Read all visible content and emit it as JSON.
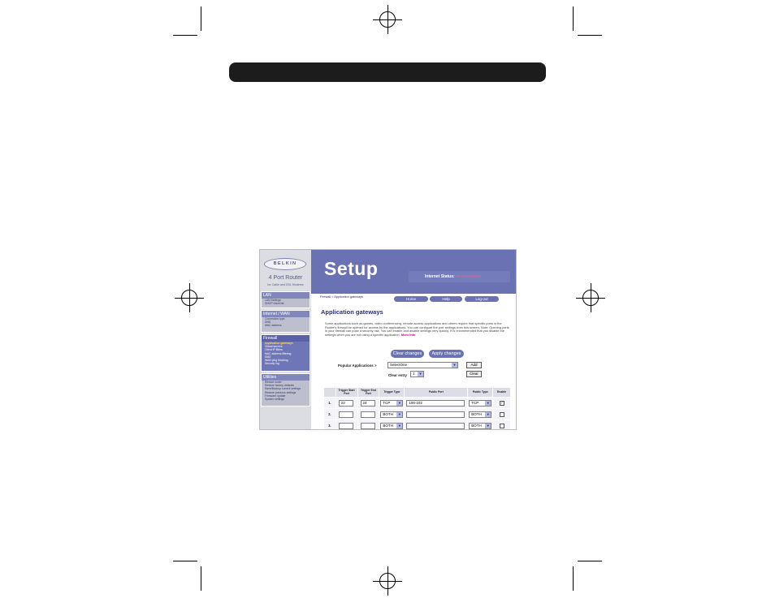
{
  "sidebar": {
    "logo": "BELKIN",
    "product_name": "4 Port Router",
    "product_sub": "for Cable and DSL Modems",
    "groups": [
      {
        "title": "LAN",
        "items": [
          "LAN Settings",
          "DHCP client list"
        ]
      },
      {
        "title": "Internet / WAN",
        "items": [
          "Connection type",
          "DNS",
          "MAC address"
        ]
      },
      {
        "title": "Firewall",
        "items": [
          "Application gateways",
          "Virtual servers",
          "Client IP filters",
          "MAC address filtering",
          "DMZ",
          "WAN ping blocking",
          "Security log"
        ]
      },
      {
        "title": "Utilities",
        "items": [
          "Restart router",
          "Restore factory defaults",
          "Save/Backup current settings",
          "Restore previous settings",
          "Firmware update",
          "System settings"
        ]
      }
    ],
    "current_item": "Application gateways"
  },
  "header": {
    "title": "Setup",
    "status_label": "Internet Status:",
    "status_value": "no connection",
    "status_color": "#ff5a7a"
  },
  "breadcrumb": "Firewall > Application gateways",
  "top_nav": {
    "home": "Home",
    "help": "Help",
    "logout": "Log-out"
  },
  "page_title": "Application gateways",
  "description": "Some applications such as games, video conferencing, remote access applications and others require that specific ports in the Router's firewall be opened for access by the applications. You can configure the port settings from this screen. Note: Opening ports in your firewall can pose a security risk. You can enable and disable settings very quickly. It is recommended that you disable the settings when you are not using a specific application.",
  "more_info": "More Info",
  "buttons": {
    "clear_changes": "Clear changes",
    "apply_changes": "Apply changes",
    "add": "Add",
    "clear": "Clear"
  },
  "popular_apps": {
    "label": "Popular Applications >",
    "selected": "SelectOne"
  },
  "clear_entry": {
    "label": "Clear entry",
    "selected": "1"
  },
  "table": {
    "columns": [
      "",
      "Trigger Start Port",
      "Trigger End Port",
      "Trigger Type",
      "Public Port",
      "Public Type",
      "Enable"
    ],
    "rows": [
      {
        "num": "1.",
        "start": "22",
        "end": "24",
        "trigger_type": "TCP",
        "public_port": "100-102",
        "public_type": "TCP",
        "enabled": "✓"
      },
      {
        "num": "2.",
        "start": "",
        "end": "",
        "trigger_type": "BOTH",
        "public_port": "",
        "public_type": "BOTH",
        "enabled": ""
      },
      {
        "num": "3.",
        "start": "",
        "end": "",
        "trigger_type": "BOTH",
        "public_port": "",
        "public_type": "BOTH",
        "enabled": ""
      }
    ]
  },
  "colors": {
    "accent": "#6a72b3",
    "dark_bar": "#1c1c1c",
    "sidebar": "#dcdce3"
  }
}
